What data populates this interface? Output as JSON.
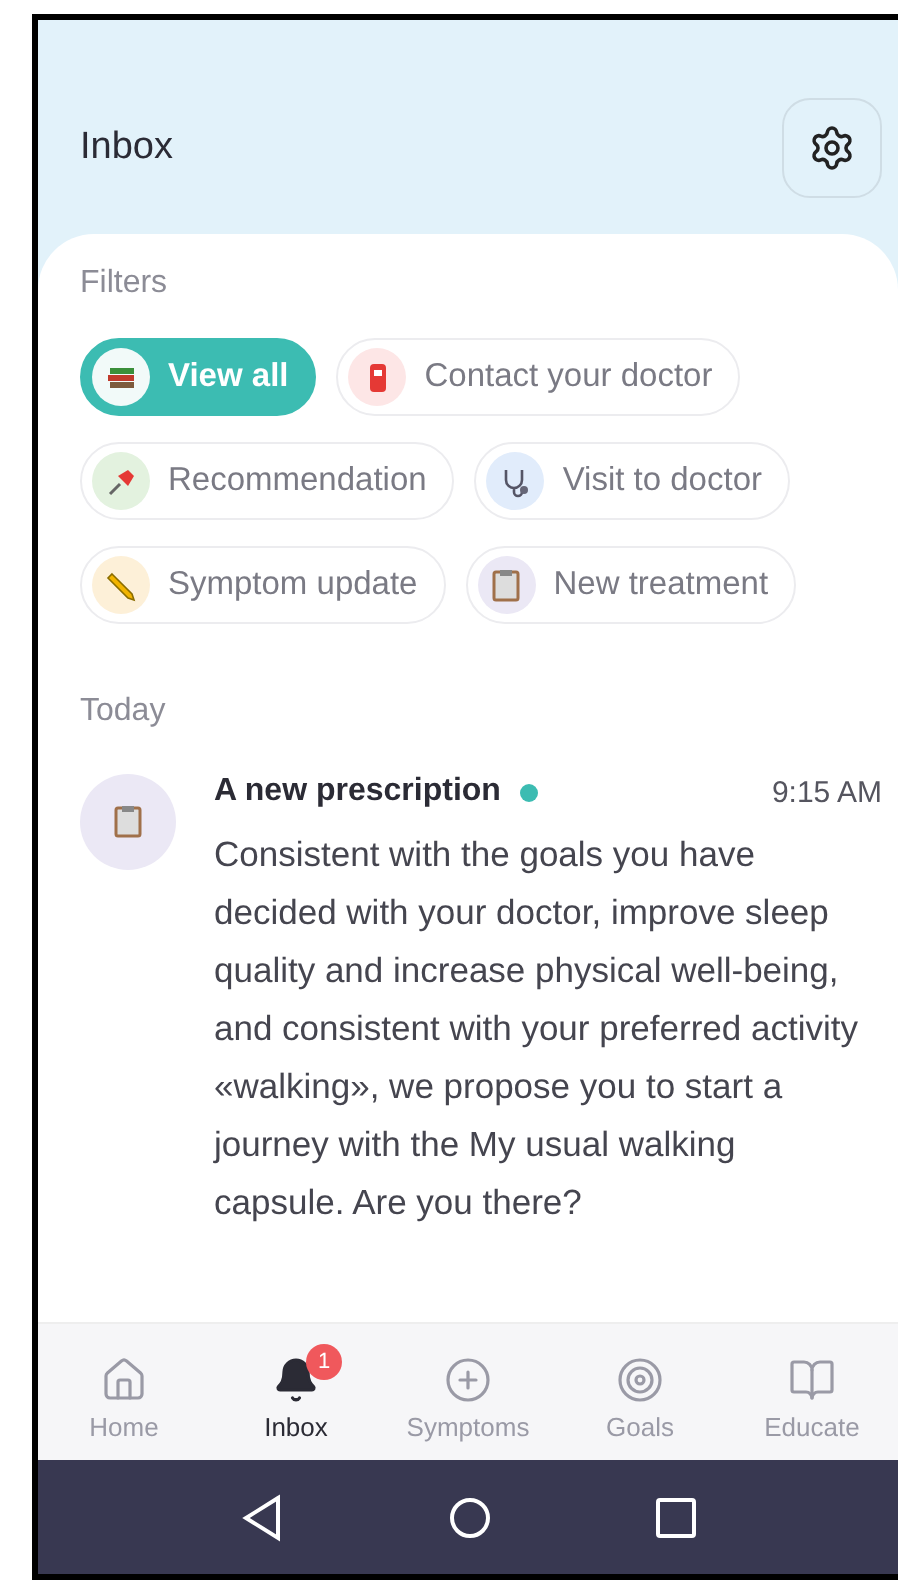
{
  "header": {
    "title": "Inbox"
  },
  "filters": {
    "label": "Filters",
    "items": [
      {
        "label": "View all",
        "selected": true,
        "kind": "books",
        "color": "#f2faf9"
      },
      {
        "label": "Contact your doctor",
        "selected": false,
        "kind": "phone",
        "color": "#fde6e6"
      },
      {
        "label": "Recommendation",
        "selected": false,
        "kind": "pin",
        "color": "#e3f2df"
      },
      {
        "label": "Visit to doctor",
        "selected": false,
        "kind": "stethoscope",
        "color": "#e1ecfb"
      },
      {
        "label": "Symptom update",
        "selected": false,
        "kind": "pencil",
        "color": "#fdf0d8"
      },
      {
        "label": "New treatment",
        "selected": false,
        "kind": "clipboard",
        "color": "#ebe8f5"
      }
    ]
  },
  "section": "Today",
  "messages": [
    {
      "title": "A new prescription",
      "unread": true,
      "time": "9:15 AM",
      "kind": "clipboard",
      "body": "Consistent with the goals you have decided with your doctor, improve sleep quality and increase physical well-being, and consistent with your preferred activity «walking», we propose you to start a journey with the My usual walking capsule. Are you there?"
    }
  ],
  "tabs": [
    {
      "label": "Home",
      "kind": "home",
      "selected": false
    },
    {
      "label": "Inbox",
      "kind": "bell",
      "selected": true,
      "badge": "1"
    },
    {
      "label": "Symptoms",
      "kind": "plus",
      "selected": false
    },
    {
      "label": "Goals",
      "kind": "target",
      "selected": false
    },
    {
      "label": "Educate",
      "kind": "book",
      "selected": false
    }
  ]
}
